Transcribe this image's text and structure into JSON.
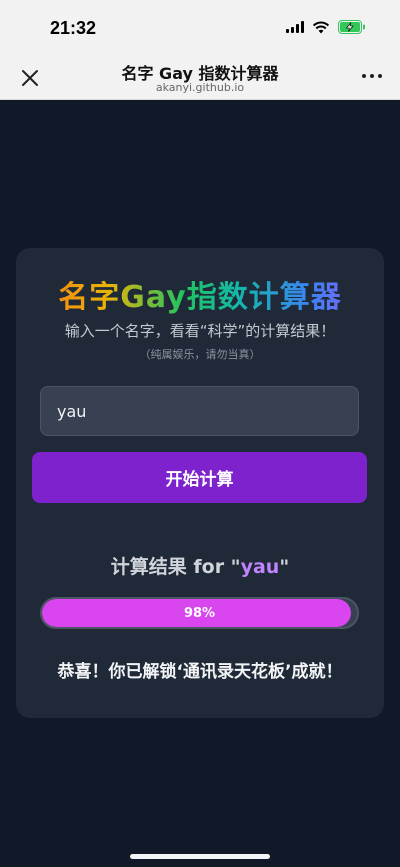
{
  "status_bar": {
    "time": "21:32",
    "icons": [
      "signal-icon",
      "wifi-icon",
      "battery-charging-icon"
    ],
    "battery_color": "#34c759"
  },
  "nav": {
    "title": "名字 Gay 指数计算器",
    "url": "akanyi.github.io",
    "icons": [
      "close-icon",
      "more-icon"
    ]
  },
  "card": {
    "title": "名字Gay指数计算器",
    "subtitle": "输入一个名字，看看“科学”的计算结果！",
    "note": "（纯属娱乐，请勿当真）",
    "input_value": "yau",
    "button_label": "开始计算"
  },
  "result": {
    "title_prefix": "计算结果 for \"",
    "name": "yau",
    "title_suffix": "\"",
    "percent": 98,
    "percent_label": "98%",
    "message": "恭喜！你已解锁‘通讯录天花板’成就！"
  },
  "colors": {
    "background": "#111827",
    "card": "#1f2937",
    "button": "#7e22ce",
    "progress_fill": "#d946ef",
    "result_name": "#c084fc"
  }
}
